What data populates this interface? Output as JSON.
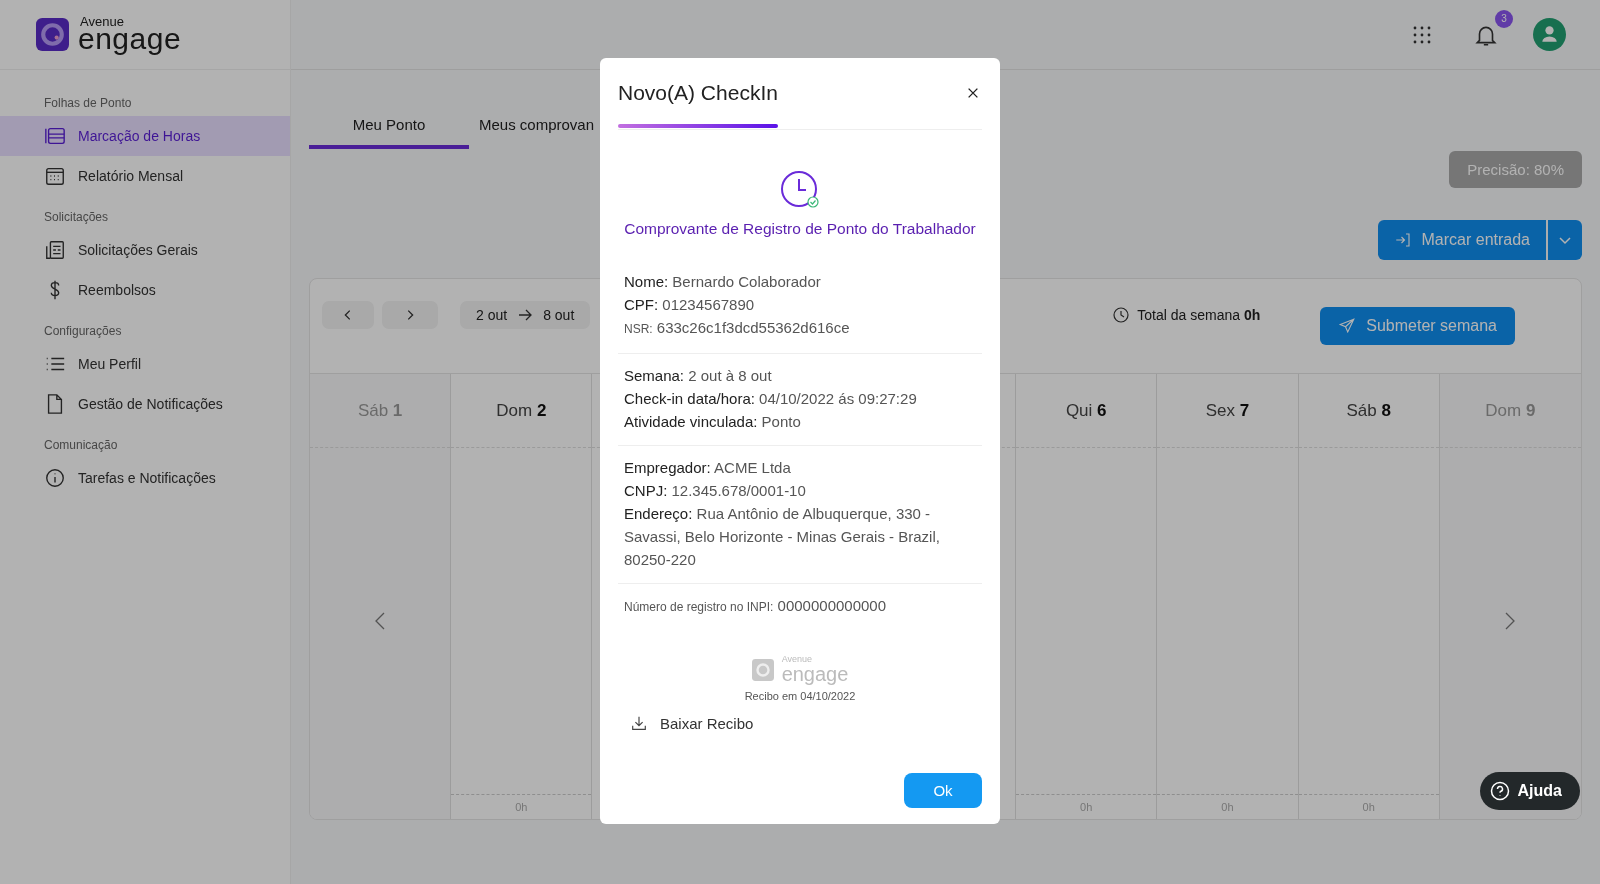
{
  "brand": {
    "top": "Avenue",
    "main": "engage"
  },
  "header": {
    "notification_count": "3"
  },
  "sidebar": {
    "sections": [
      {
        "title": "Folhas de Ponto",
        "items": [
          {
            "label": "Marcação de Horas",
            "selected": true
          },
          {
            "label": "Relatório Mensal",
            "selected": false
          }
        ]
      },
      {
        "title": "Solicitações",
        "items": [
          {
            "label": "Solicitações Gerais",
            "selected": false
          },
          {
            "label": "Reembolsos",
            "selected": false
          }
        ]
      },
      {
        "title": "Configurações",
        "items": [
          {
            "label": "Meu Perfil",
            "selected": false
          },
          {
            "label": "Gestão de Notificações",
            "selected": false
          }
        ]
      },
      {
        "title": "Comunicação",
        "items": [
          {
            "label": "Tarefas e Notificações",
            "selected": false
          }
        ]
      }
    ]
  },
  "tabs": [
    {
      "label": "Meu Ponto",
      "selected": true
    },
    {
      "label": "Meus comprovan",
      "selected": false
    }
  ],
  "precision_button": {
    "label": "Precisão: 80%",
    "disabled": true
  },
  "mark_button": {
    "label": "Marcar entrada"
  },
  "week_toolbar": {
    "range_from": "2 out",
    "range_to": "8 out",
    "total_label": "Total da semana",
    "total_value": "0h",
    "submit": "Submeter semana"
  },
  "days": [
    {
      "name": "Sáb",
      "number": "1",
      "in_week": false
    },
    {
      "name": "Dom",
      "number": "2",
      "in_week": true,
      "hours": "0h"
    },
    {
      "name": "Qui",
      "number": "6",
      "in_week": true,
      "hours": "0h"
    },
    {
      "name": "Sex",
      "number": "7",
      "in_week": true,
      "hours": "0h"
    },
    {
      "name": "Sáb",
      "number": "8",
      "in_week": true,
      "hours": "0h"
    },
    {
      "name": "Dom",
      "number": "9",
      "in_week": false
    }
  ],
  "modal": {
    "title": "Novo(A) CheckIn",
    "heading": "Comprovante de Registro de Ponto do Trabalhador",
    "groups": [
      [
        {
          "label": "Nome:",
          "value": "Bernardo Colaborador",
          "small": false
        },
        {
          "label": "CPF:",
          "value": "01234567890",
          "small": false
        },
        {
          "label": "NSR:",
          "value": "633c26c1f3dcd55362d616ce",
          "small": true
        }
      ],
      [
        {
          "label": "Semana:",
          "value": "2 out à 8 out",
          "small": false
        },
        {
          "label": "Check-in data/hora:",
          "value": "04/10/2022 ás 09:27:29",
          "small": false
        },
        {
          "label": "Atividade vinculada:",
          "value": "Ponto",
          "small": false
        }
      ],
      [
        {
          "label": "Empregador:",
          "value": "ACME Ltda",
          "small": false
        },
        {
          "label": "CNPJ:",
          "value": "12.345.678/0001-10",
          "small": false
        },
        {
          "label": "Endereço:",
          "value": "Rua Antônio de Albuquerque, 330 - Savassi, Belo Horizonte - Minas Gerais - Brazil, 80250-220",
          "small": false
        }
      ],
      [
        {
          "label": "Número de registro no INPI:",
          "value": "0000000000000",
          "small": true
        }
      ]
    ],
    "logo": {
      "top": "Avenue",
      "main": "engage"
    },
    "receipt_date": "Recibo em 04/10/2022",
    "download": "Baixar Recibo",
    "ok": "Ok"
  },
  "help_button": "Ajuda"
}
